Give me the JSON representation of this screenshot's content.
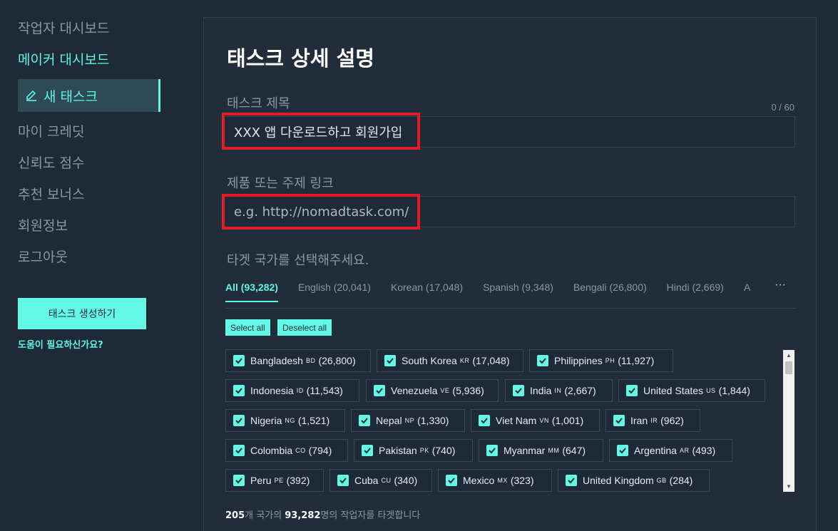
{
  "sidebar": {
    "worker_dashboard": "작업자 대시보드",
    "maker_dashboard": "메이커 대시보드",
    "new_task": "새 태스크",
    "my_credit": "마이 크레딧",
    "trust_score": "신뢰도 점수",
    "referral_bonus": "추천 보너스",
    "member_info": "회원정보",
    "logout": "로그아웃",
    "create_button": "태스크 생성하기",
    "help_link": "도움이 필요하신가요?"
  },
  "main": {
    "title": "태스크 상세 설명",
    "task_title_label": "태스크 제목",
    "char_count": "0 / 60",
    "task_title_value": "XXX 앱 다운로드하고 회원가입",
    "link_label": "제품 또는 주제 링크",
    "link_placeholder": "e.g. http://nomadtask.com/",
    "country_prompt": "타겟 국가를 선택해주세요.",
    "tabs": [
      {
        "label": "All (93,282)"
      },
      {
        "label": "English (20,041)"
      },
      {
        "label": "Korean (17,048)"
      },
      {
        "label": "Spanish (9,348)"
      },
      {
        "label": "Bengali (26,800)"
      },
      {
        "label": "Hindi (2,669)"
      },
      {
        "label": "A"
      }
    ],
    "tab_more": "···",
    "select_all": "Select all",
    "deselect_all": "Deselect all",
    "countries": [
      {
        "name": "Bangladesh",
        "code": "BD",
        "count": "(26,800)"
      },
      {
        "name": "South Korea",
        "code": "KR",
        "count": "(17,048)"
      },
      {
        "name": "Philippines",
        "code": "PH",
        "count": "(11,927)"
      },
      {
        "name": "Indonesia",
        "code": "ID",
        "count": "(11,543)"
      },
      {
        "name": "Venezuela",
        "code": "VE",
        "count": "(5,936)"
      },
      {
        "name": "India",
        "code": "IN",
        "count": "(2,667)"
      },
      {
        "name": "United States",
        "code": "US",
        "count": "(1,844)"
      },
      {
        "name": "Nigeria",
        "code": "NG",
        "count": "(1,521)"
      },
      {
        "name": "Nepal",
        "code": "NP",
        "count": "(1,330)"
      },
      {
        "name": "Viet Nam",
        "code": "VN",
        "count": "(1,001)"
      },
      {
        "name": "Iran",
        "code": "IR",
        "count": "(962)"
      },
      {
        "name": "Colombia",
        "code": "CO",
        "count": "(794)"
      },
      {
        "name": "Pakistan",
        "code": "PK",
        "count": "(740)"
      },
      {
        "name": "Myanmar",
        "code": "MM",
        "count": "(647)"
      },
      {
        "name": "Argentina",
        "code": "AR",
        "count": "(493)"
      },
      {
        "name": "Peru",
        "code": "PE",
        "count": "(392)"
      },
      {
        "name": "Cuba",
        "code": "CU",
        "count": "(340)"
      },
      {
        "name": "Mexico",
        "code": "MX",
        "count": "(323)"
      },
      {
        "name": "United Kingdom",
        "code": "GB",
        "count": "(284)"
      }
    ],
    "summary": {
      "country_count": "205",
      "text1": "개 국가의 ",
      "worker_count": "93,282",
      "text2": "명의 작업자를 타겟합니다"
    }
  },
  "colors": {
    "background": "#1f2a38",
    "panel": "#222d3b",
    "accent": "#5ff5e3",
    "button": "#62f8e5",
    "highlight": "#e31c24"
  }
}
